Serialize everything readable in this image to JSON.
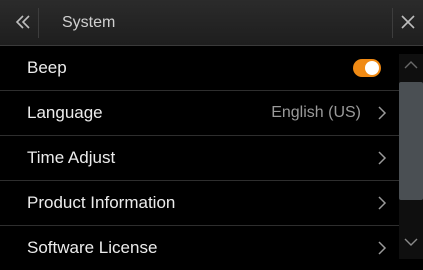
{
  "header": {
    "back_icon": "double-chevron-left-icon",
    "title": "System",
    "close_icon": "close-icon"
  },
  "rows": [
    {
      "label": "Beep",
      "control": "toggle",
      "toggle_on": true
    },
    {
      "label": "Language",
      "value": "English (US)",
      "control": "chevron"
    },
    {
      "label": "Time Adjust",
      "control": "chevron"
    },
    {
      "label": "Product Information",
      "control": "chevron"
    },
    {
      "label": "Software License",
      "control": "chevron"
    }
  ],
  "colors": {
    "accent": "#f08a14",
    "background": "#000000",
    "header": "#242424"
  }
}
